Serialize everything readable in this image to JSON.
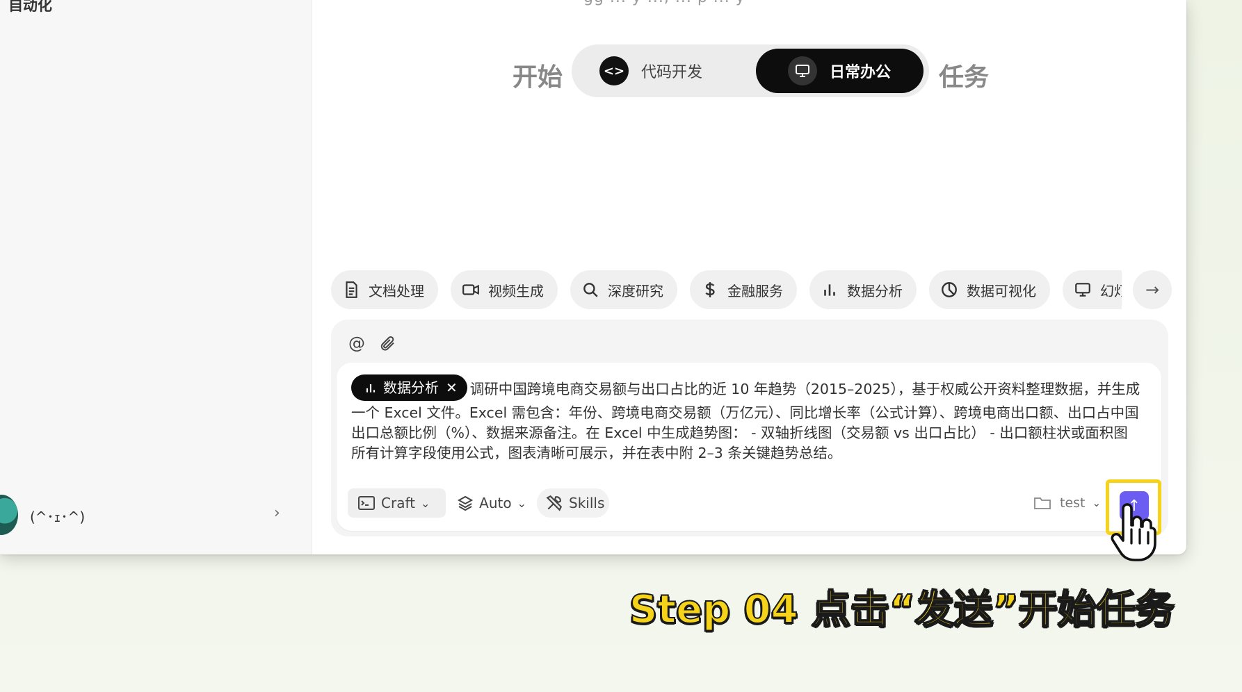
{
  "sidebar": {
    "section_title": "自动化",
    "user": {
      "name": "(^･ｪ･^)"
    }
  },
  "main": {
    "top_faded_text": "gg ... y ..., ... p ... y",
    "mode": {
      "prefix": "开始",
      "suffix": "任务",
      "options": [
        {
          "label": "代码开发",
          "selected": false
        },
        {
          "label": "日常办公",
          "selected": true
        }
      ]
    },
    "skill_chips": [
      {
        "label": "文档处理",
        "icon": "document-icon"
      },
      {
        "label": "视频生成",
        "icon": "video-camera-icon"
      },
      {
        "label": "深度研究",
        "icon": "search-icon"
      },
      {
        "label": "金融服务",
        "icon": "dollar-icon"
      },
      {
        "label": "数据分析",
        "icon": "bar-chart-icon"
      },
      {
        "label": "数据可视化",
        "icon": "pie-chart-icon"
      },
      {
        "label": "幻灯",
        "icon": "monitor-icon"
      }
    ],
    "composer": {
      "tag": "数据分析",
      "prompt": "调研中国跨境电商交易额与出口占比的近 10 年趋势（2015–2025），基于权威公开资料整理数据，并生成一个 Excel 文件。Excel 需包含：年份、跨境电商交易额（万亿元）、同比增长率（公式计算）、跨境电商出口额、出口占中国出口总额比例（%）、数据来源备注。在 Excel 中生成趋势图： - 双轴折线图（交易额 vs 出口占比） - 出口额柱状或面积图 所有计算字段使用公式，图表清晰可展示，并在表中附 2–3 条关键趋势总结。",
      "mode_select": "Craft",
      "model_select": "Auto",
      "skills_label": "Skills",
      "project_select": "test"
    }
  },
  "caption": "Step 04 点击“发送”开始任务",
  "colors": {
    "accent_send": "#6b5cf2",
    "highlight": "#f5d31a",
    "selected_mode_bg": "#0d0d0d"
  }
}
